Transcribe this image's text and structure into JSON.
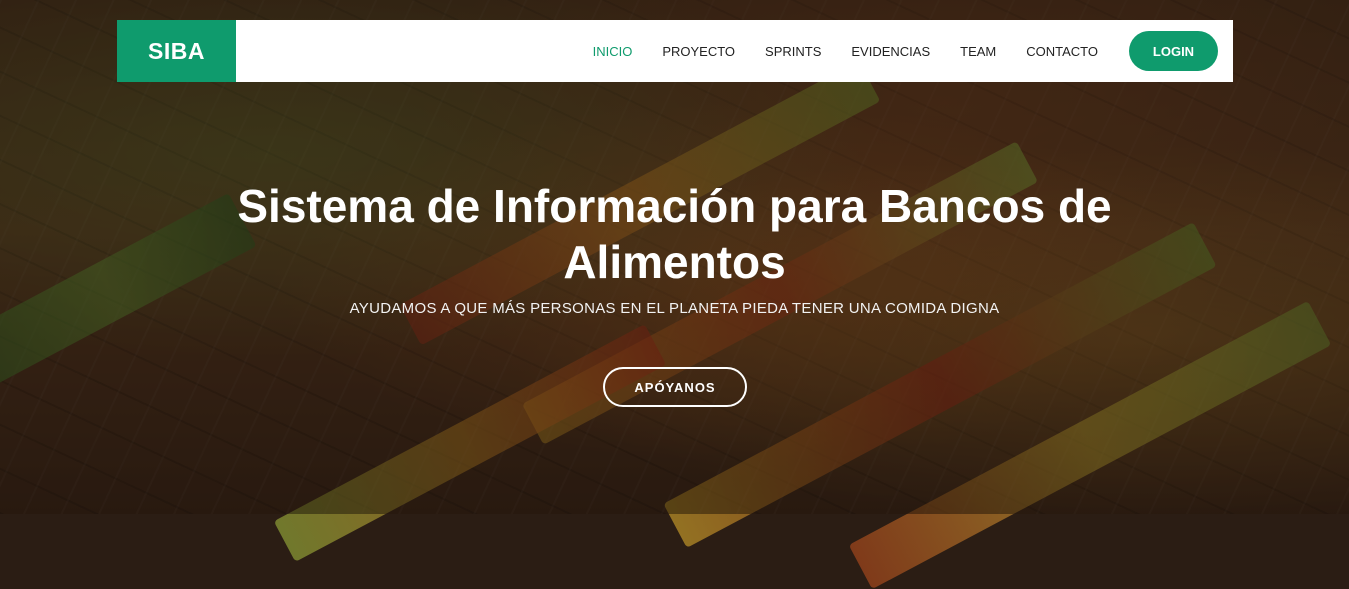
{
  "brand": {
    "logo_text": "SIBA",
    "accent_color": "#0f9b6d"
  },
  "nav": {
    "items": [
      {
        "label": "INICIO",
        "active": true
      },
      {
        "label": "PROYECTO",
        "active": false
      },
      {
        "label": "SPRINTS",
        "active": false
      },
      {
        "label": "EVIDENCIAS",
        "active": false
      },
      {
        "label": "TEAM",
        "active": false
      },
      {
        "label": "CONTACTO",
        "active": false
      }
    ],
    "login_label": "LOGIN"
  },
  "hero": {
    "title": "Sistema de Información para Bancos de Alimentos",
    "subtitle": "AYUDAMOS A QUE MÁS PERSONAS EN EL PLANETA PIEDA TENER UNA COMIDA DIGNA",
    "cta_label": "APÓYANOS",
    "background": "supermarket-produce-photo"
  }
}
